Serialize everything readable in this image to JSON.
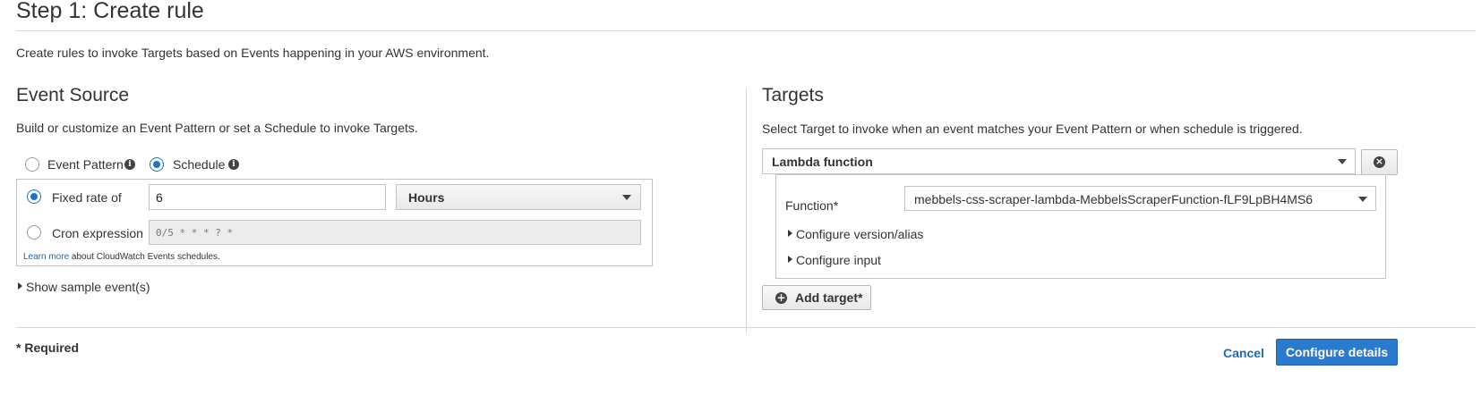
{
  "page": {
    "title": "Step 1: Create rule",
    "description": "Create rules to invoke Targets based on Events happening in your AWS environment."
  },
  "event_source": {
    "title": "Event Source",
    "description": "Build or customize an Event Pattern or set a Schedule to invoke Targets.",
    "options": {
      "event_pattern": "Event Pattern",
      "schedule": "Schedule",
      "selected": "Schedule"
    },
    "fixed_rate_label": "Fixed rate of",
    "fixed_rate_value": "6",
    "rate_unit": "Hours",
    "cron_label": "Cron expression",
    "cron_placeholder": "0/5 * * * ? *",
    "learn_more_link": "Learn more",
    "learn_more_rest": " about CloudWatch Events schedules.",
    "show_sample": "Show sample event(s)"
  },
  "targets": {
    "title": "Targets",
    "description": "Select Target to invoke when an event matches your Event Pattern or when schedule is triggered.",
    "target_type": "Lambda function",
    "function_label": "Function*",
    "function_value": "mebbels-css-scraper-lambda-MebbelsScraperFunction-fLF9LpBH4MS6",
    "configure_version": "Configure version/alias",
    "configure_input": "Configure input",
    "add_target": "Add target*"
  },
  "footer": {
    "required_note": "* Required",
    "cancel": "Cancel",
    "configure_details": "Configure details"
  },
  "colors": {
    "accent": "#2a7bcd",
    "link": "#1a6bb5",
    "border": "#c4c4c4"
  },
  "icons": [
    "info-icon",
    "caret-down-icon",
    "expand-triangle-icon",
    "remove-icon",
    "plus-circle-icon"
  ]
}
